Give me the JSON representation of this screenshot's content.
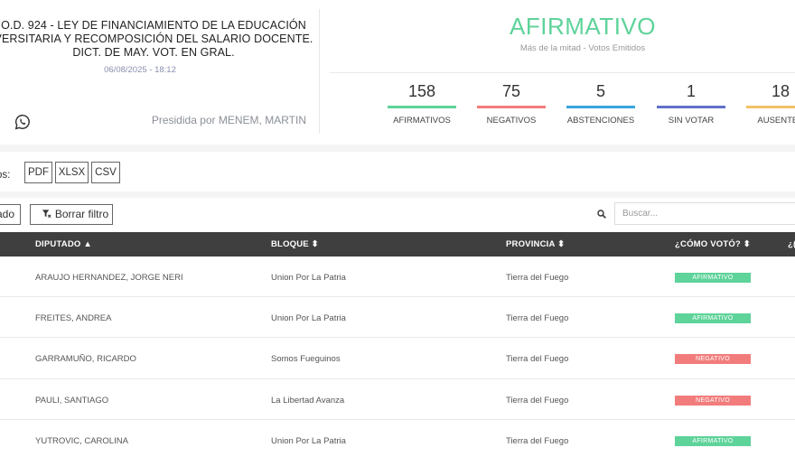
{
  "header": {
    "title_lines": [
      "O.D. 924 - LEY DE FINANCIAMIENTO DE LA EDUCACIÓN",
      "VERSITARIA Y RECOMPOSICIÓN DEL SALARIO DOCENTE.",
      "DICT. DE MAY. VOT. EN GRAL."
    ],
    "datetime": "06/08/2025 - 18:12",
    "presided_by": "Presidida por MENEM, MARTIN",
    "share_icon": "whatsapp-icon"
  },
  "result": {
    "label": "AFIRMATIVO",
    "subtitle": "Más de la mitad - Votos Emitidos",
    "color": "#5ed39a"
  },
  "stats": [
    {
      "value": "158",
      "label": "AFIRMATIVOS",
      "color": "#5ed39a"
    },
    {
      "value": "75",
      "label": "NEGATIVOS",
      "color": "#f27c7c"
    },
    {
      "value": "5",
      "label": "ABSTENCIONES",
      "color": "#3aa6dd"
    },
    {
      "value": "1",
      "label": "SIN VOTAR",
      "color": "#6170c9"
    },
    {
      "value": "18",
      "label": "AUSENTES",
      "color": "#f3c266"
    }
  ],
  "export": {
    "label": "os:",
    "buttons": [
      "PDF",
      "XLSX",
      "CSV"
    ]
  },
  "filters": {
    "partial_button": "ado",
    "clear_filter": "Borrar filtro",
    "search_placeholder": "Buscar..."
  },
  "table": {
    "headers": {
      "diputado": "DIPUTADO ▲",
      "bloque": "BLOQUE ⬍",
      "provincia": "PROVINCIA ⬍",
      "voto": "¿CÓMO VOTÓ? ⬍",
      "extra": "¿("
    },
    "rows": [
      {
        "diputado": "ARAUJO HERNANDEZ, JORGE NERI",
        "bloque": "Union Por La Patria",
        "provincia": "Tierra del Fuego",
        "voto": "AFIRMATIVO",
        "color": "#5ed39a"
      },
      {
        "diputado": "FREITES, ANDREA",
        "bloque": "Union Por La Patria",
        "provincia": "Tierra del Fuego",
        "voto": "AFIRMATIVO",
        "color": "#5ed39a"
      },
      {
        "diputado": "GARRAMUÑO, RICARDO",
        "bloque": "Somos Fueguinos",
        "provincia": "Tierra del Fuego",
        "voto": "NEGATIVO",
        "color": "#f27c7c"
      },
      {
        "diputado": "PAULI, SANTIAGO",
        "bloque": "La Libertad Avanza",
        "provincia": "Tierra del Fuego",
        "voto": "NEGATIVO",
        "color": "#f27c7c"
      },
      {
        "diputado": "YUTROVIC, CAROLINA",
        "bloque": "Union Por La Patria",
        "provincia": "Tierra del Fuego",
        "voto": "AFIRMATIVO",
        "color": "#5ed39a"
      }
    ]
  }
}
